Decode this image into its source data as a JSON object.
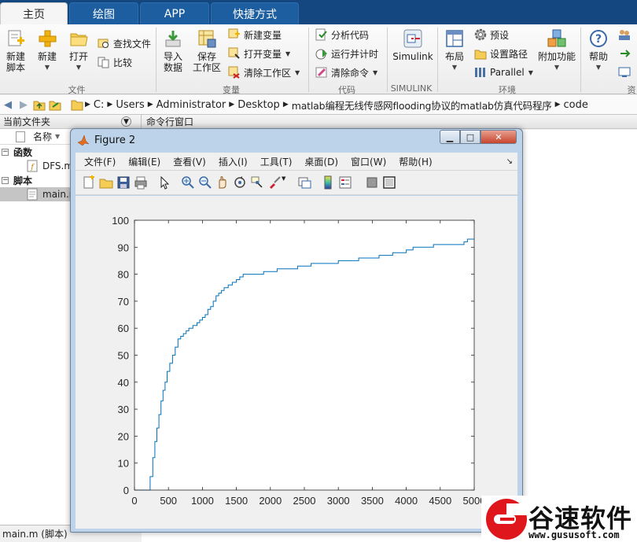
{
  "tabs": [
    {
      "label": "主页",
      "active": true
    },
    {
      "label": "绘图",
      "active": false
    },
    {
      "label": "APP",
      "active": false
    },
    {
      "label": "快捷方式",
      "active": false
    }
  ],
  "ribbon": {
    "new_script": "新建\n脚本",
    "new": "新建",
    "open": "打开",
    "find_files": "查找文件",
    "compare": "比较",
    "import_data": "导入\n数据",
    "save_workspace": "保存\n工作区",
    "new_variable": "新建变量",
    "open_variable": "打开变量",
    "clear_workspace": "清除工作区",
    "analyze_code": "分析代码",
    "run_and_time": "运行并计时",
    "clear_commands": "清除命令",
    "simulink": "Simulink",
    "layout": "布局",
    "preferences": "预设",
    "set_path": "设置路径",
    "parallel": "Parallel",
    "addons": "附加功能",
    "help": "帮助",
    "groups": {
      "file": "文件",
      "variable": "变量",
      "code": "代码",
      "simulink": "SIMULINK",
      "environment": "环境",
      "resources": "资"
    }
  },
  "address": {
    "crumbs": [
      "C:",
      "Users",
      "Administrator",
      "Desktop",
      "matlab编程无线传感网flooding协议的matlab仿真代码程序",
      "code"
    ]
  },
  "filebrowser": {
    "title": "当前文件夹",
    "col_name": "名称",
    "group_functions": "函数",
    "file_dfs": "DFS.m",
    "group_scripts": "脚本",
    "file_main": "main.m",
    "status": "main.m  (脚本)"
  },
  "command_window": {
    "title": "命令行窗口"
  },
  "figure": {
    "title": "Figure 2",
    "menus": [
      "文件(F)",
      "编辑(E)",
      "查看(V)",
      "插入(I)",
      "工具(T)",
      "桌面(D)",
      "窗口(W)",
      "帮助(H)"
    ]
  },
  "chart_data": {
    "type": "line",
    "title": "",
    "xlabel": "",
    "ylabel": "",
    "xlim": [
      0,
      5000
    ],
    "ylim": [
      0,
      100
    ],
    "xticks": [
      0,
      500,
      1000,
      1500,
      2000,
      2500,
      3000,
      3500,
      4000,
      4500,
      5000
    ],
    "yticks": [
      0,
      10,
      20,
      30,
      40,
      50,
      60,
      70,
      80,
      90,
      100
    ],
    "grid": false,
    "color": "#0072bd",
    "series": [
      {
        "step": true,
        "x": [
          0,
          190,
          230,
          270,
          300,
          330,
          360,
          390,
          420,
          450,
          480,
          520,
          560,
          600,
          640,
          680,
          720,
          760,
          800,
          860,
          920,
          960,
          1000,
          1040,
          1080,
          1120,
          1160,
          1200,
          1240,
          1280,
          1320,
          1380,
          1440,
          1500,
          1550,
          1600,
          1900,
          2100,
          2400,
          2600,
          3000,
          3300,
          3600,
          3800,
          3900,
          4000,
          4100,
          4200,
          4300,
          4400,
          4500,
          4600,
          4800,
          4850,
          4900,
          5000
        ],
        "y": [
          0,
          0,
          5,
          12,
          18,
          23,
          28,
          33,
          37,
          40,
          44,
          47,
          50,
          53,
          56,
          57,
          58,
          59,
          60,
          61,
          62,
          63,
          64,
          65,
          67,
          68,
          70,
          72,
          73,
          74,
          75,
          76,
          77,
          78,
          79,
          80,
          81,
          82,
          83,
          84,
          85,
          86,
          87,
          88,
          88,
          89,
          90,
          90,
          90,
          91,
          91,
          91,
          91,
          92,
          93,
          93
        ]
      }
    ]
  },
  "watermark": {
    "brand": "谷速软件",
    "url": "www.gususoft.com"
  }
}
